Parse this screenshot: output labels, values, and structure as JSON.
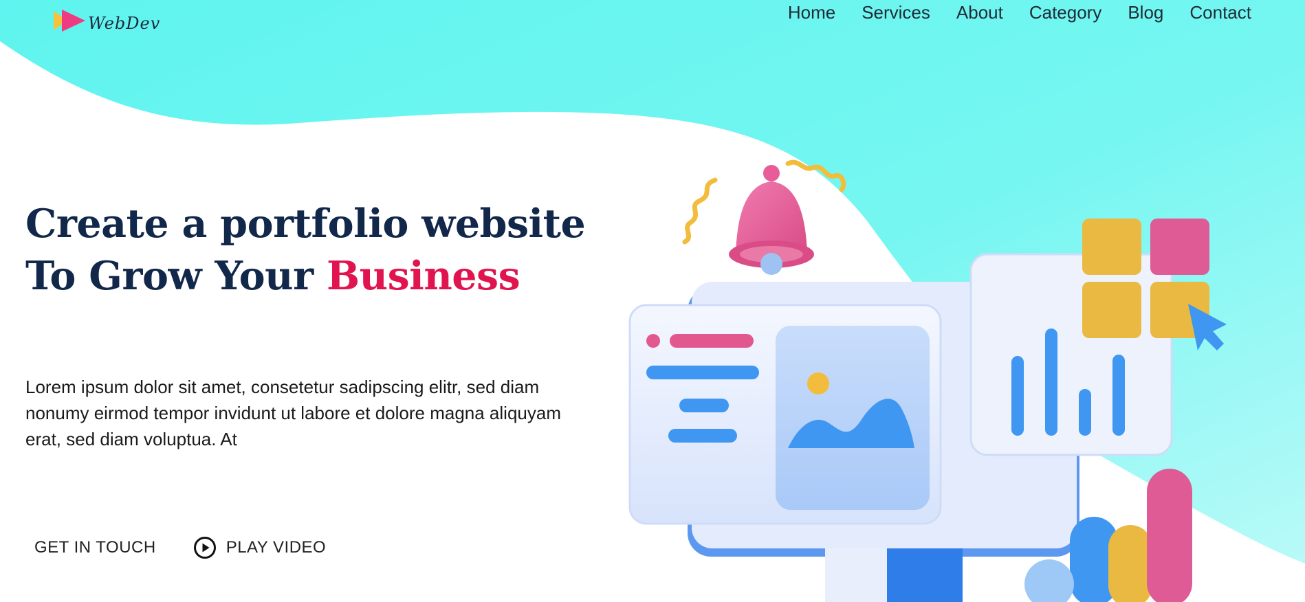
{
  "brand": {
    "name": "WebDev"
  },
  "nav": {
    "items": [
      {
        "label": "Home"
      },
      {
        "label": "Services"
      },
      {
        "label": "About"
      },
      {
        "label": "Category"
      },
      {
        "label": "Blog"
      },
      {
        "label": "Contact"
      }
    ]
  },
  "hero": {
    "title_part1": "Create a portfolio website To Grow Your",
    "title_accent": "Business",
    "description": "Lorem ipsum dolor sit amet, consetetur sadipscing elitr, sed diam nonumy eirmod tempor invidunt ut labore et dolore magna aliquyam erat, sed diam voluptua. At",
    "cta_primary": "GET IN TOUCH",
    "cta_secondary": "PLAY VIDEO"
  },
  "icons": {
    "logo": "play-logo-icon",
    "video": "play-circle-icon"
  },
  "colors": {
    "background_wave": "#66f5f0",
    "title_text": "#12284a",
    "accent": "#e0144f",
    "body_text": "#1a1a1a"
  }
}
